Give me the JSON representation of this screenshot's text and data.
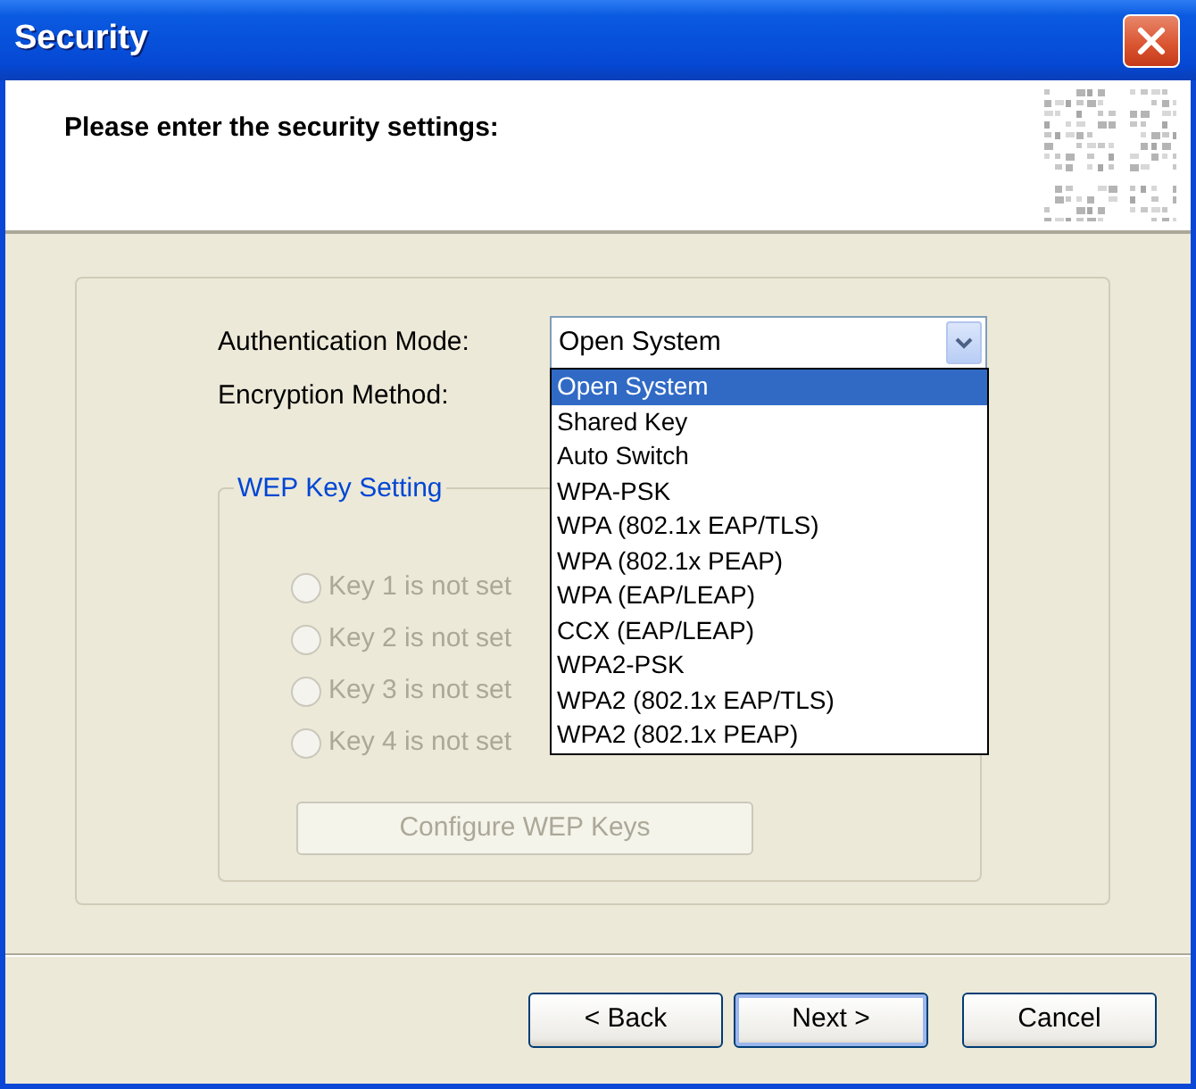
{
  "window": {
    "title": "Security"
  },
  "header": {
    "text": "Please enter the security settings:"
  },
  "auth_mode": {
    "label": "Authentication Mode:",
    "value": "Open System",
    "expanded": true,
    "options": [
      {
        "label": "Open System",
        "selected": true
      },
      {
        "label": "Shared Key",
        "selected": false
      },
      {
        "label": "Auto Switch",
        "selected": false
      },
      {
        "label": "WPA-PSK",
        "selected": false
      },
      {
        "label": "WPA (802.1x EAP/TLS)",
        "selected": false
      },
      {
        "label": "WPA (802.1x PEAP)",
        "selected": false
      },
      {
        "label": "WPA (EAP/LEAP)",
        "selected": false
      },
      {
        "label": "CCX (EAP/LEAP)",
        "selected": false
      },
      {
        "label": "WPA2-PSK",
        "selected": false
      },
      {
        "label": "WPA2 (802.1x EAP/TLS)",
        "selected": false
      },
      {
        "label": "WPA2 (802.1x PEAP)",
        "selected": false
      }
    ]
  },
  "encryption_method": {
    "label": "Encryption Method:"
  },
  "wep_group": {
    "title": "WEP Key Setting",
    "keys": [
      {
        "label": "Key 1 is not set",
        "checked": false,
        "disabled": true
      },
      {
        "label": "Key 2 is not set",
        "checked": false,
        "disabled": true
      },
      {
        "label": "Key 3 is not set",
        "checked": false,
        "disabled": true
      },
      {
        "label": "Key 4 is not set",
        "checked": false,
        "disabled": true
      }
    ],
    "configure_button": {
      "label": "Configure WEP Keys",
      "disabled": true
    }
  },
  "buttons": [
    {
      "label": "< Back",
      "default": false
    },
    {
      "label": "Next >",
      "default": true
    },
    {
      "label": "Cancel",
      "default": false
    }
  ]
}
